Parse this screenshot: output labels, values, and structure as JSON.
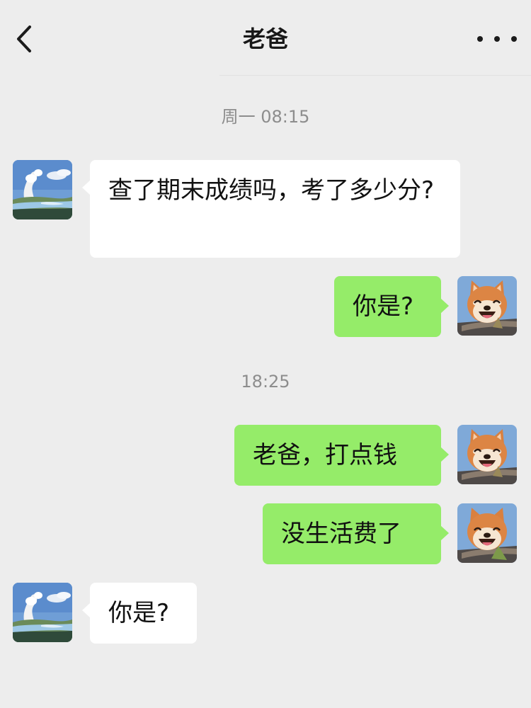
{
  "header": {
    "title": "老爸",
    "back_icon": "chevron-left-icon",
    "more_icon": "more-dots-icon"
  },
  "timestamps": [
    "周一 08:15",
    "18:25"
  ],
  "avatars": {
    "dad": "landscape-avatar",
    "me": "shiba-dog-avatar"
  },
  "messages": [
    {
      "sender": "dad",
      "text": "查了期末成绩吗，考了多少分?"
    },
    {
      "sender": "me",
      "text": "你是?"
    },
    {
      "sender": "me",
      "text": "老爸，打点钱"
    },
    {
      "sender": "me",
      "text": "没生活费了"
    },
    {
      "sender": "dad",
      "text": "你是?"
    }
  ],
  "colors": {
    "background": "#ededed",
    "incoming_bubble": "#ffffff",
    "outgoing_bubble": "#95ec69"
  }
}
